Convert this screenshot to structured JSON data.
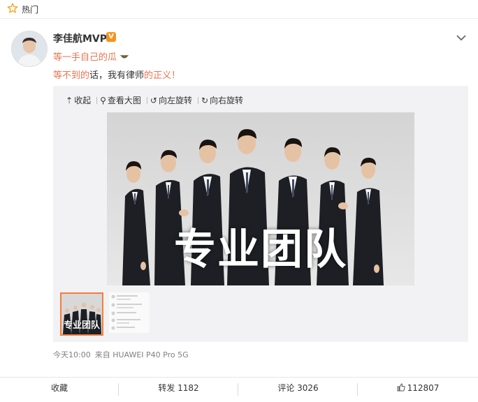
{
  "topbar": {
    "label": "热门",
    "icon": "star-icon"
  },
  "post": {
    "username": "李佳航MVP",
    "badge_icon": "v-badge-icon",
    "line1": "等一手自己的瓜",
    "line1_emoji": "melon-emoji-icon",
    "line2_a": "等不到",
    "line2_b": "的",
    "line2_c": "话，我有律师",
    "line2_d": "的",
    "line2_e": "正义！"
  },
  "media": {
    "tools": {
      "collapse": "收起",
      "view_large": "查看大图",
      "rotate_left": "向左旋转",
      "rotate_right": "向右旋转"
    },
    "image_caption": "专业团队",
    "thumb_caption": "专业团队"
  },
  "meta": {
    "time": "今天10:00",
    "source": "来自 HUAWEI P40 Pro 5G"
  },
  "actions": {
    "favorite": "收藏",
    "repost": "转发 1182",
    "comment": "评论 3026",
    "like": "112807"
  },
  "colors": {
    "accent": "#eb7350",
    "badge": "#f7931e",
    "thumb_border": "#f47c3c"
  }
}
